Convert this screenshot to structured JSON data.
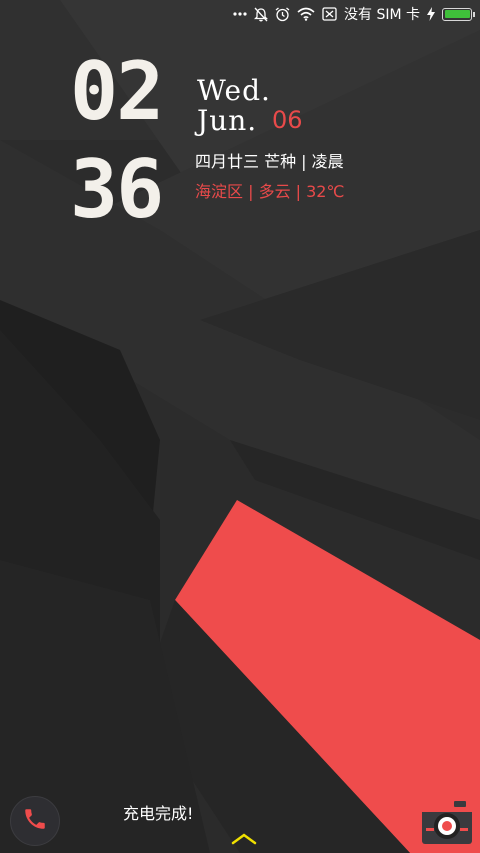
{
  "status_bar": {
    "carrier": "没有 SIM 卡",
    "battery_level": 1.0,
    "icons": [
      "more-dots-icon",
      "alarm-off-icon",
      "alarm-clock-icon",
      "wifi-icon",
      "sim-blocked-icon",
      "charging-bolt-icon",
      "battery-icon"
    ]
  },
  "clock": {
    "hours": "02",
    "minutes": "36"
  },
  "date": {
    "weekday": "Wed.",
    "month": "Jun.",
    "day": "06"
  },
  "lunar_line": "四月廿三 芒种 | 凌晨",
  "weather_line": "海淀区 | 多云 | 32℃",
  "charging_status": "充电完成!",
  "colors": {
    "accent": "#e84a4a",
    "background": "#2a2a2a",
    "battery": "#3fc03a",
    "unlock_arrow": "#f0e000"
  }
}
